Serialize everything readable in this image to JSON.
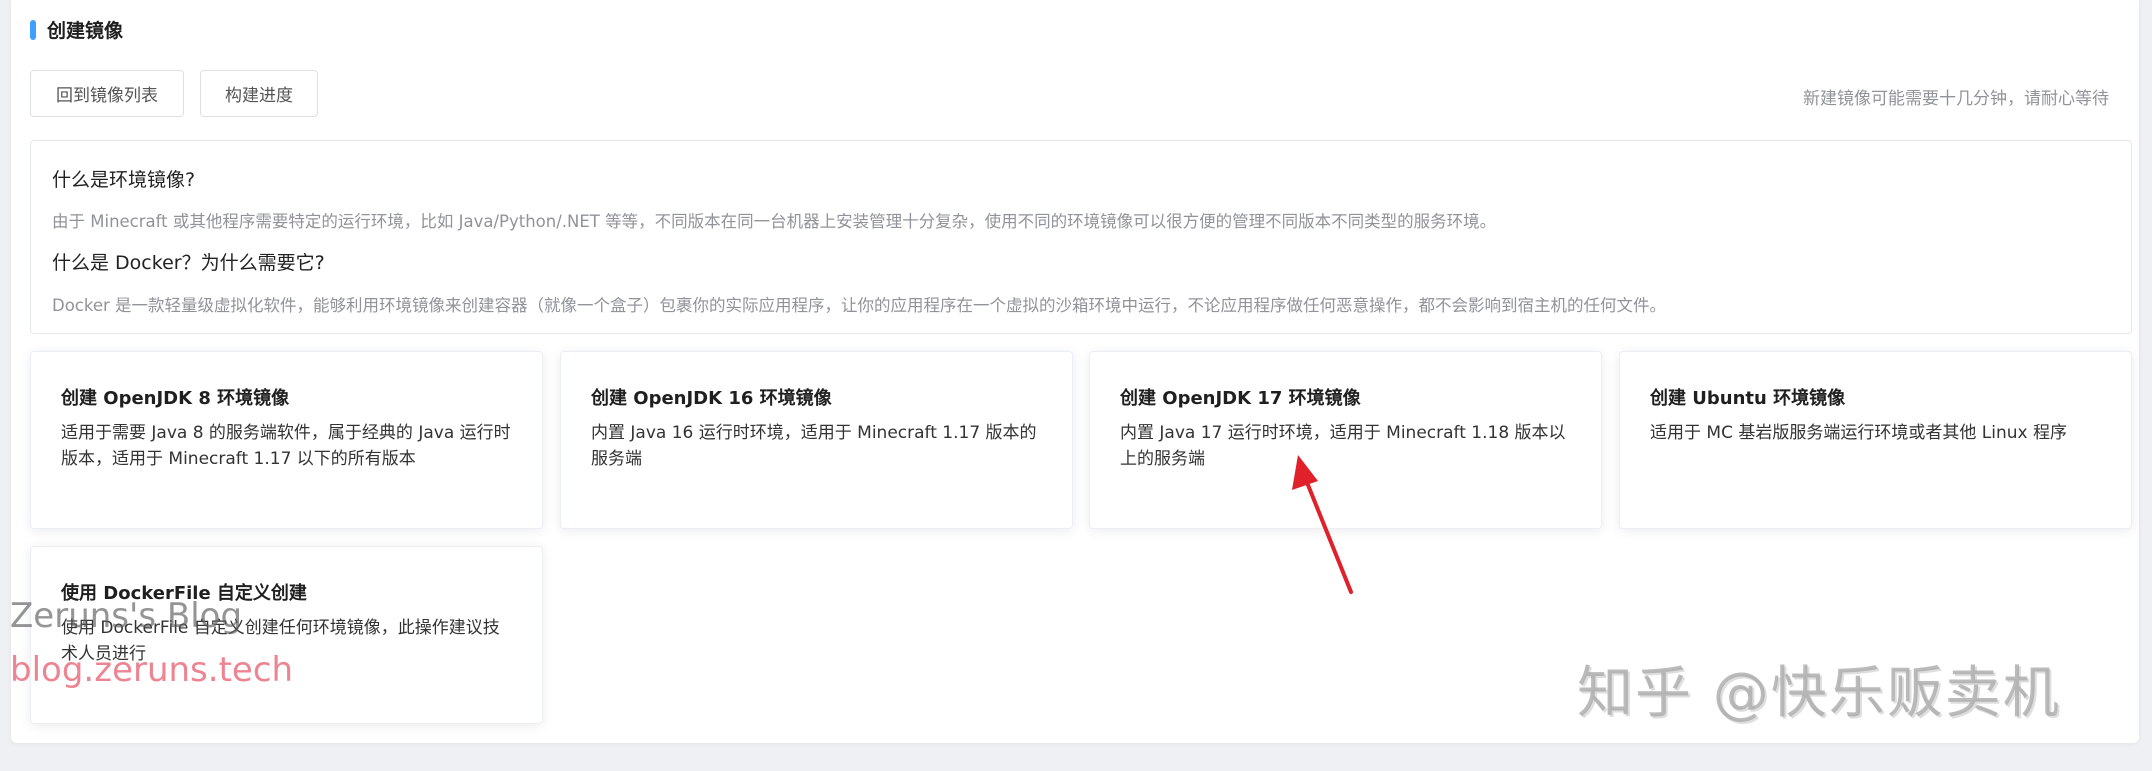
{
  "header": {
    "title": "创建镜像",
    "hint": "新建镜像可能需要十几分钟，请耐心等待"
  },
  "toolbar": {
    "back_label": "回到镜像列表",
    "progress_label": "构建进度"
  },
  "info": {
    "q1": "什么是环境镜像?",
    "a1": "由于 Minecraft 或其他程序需要特定的运行环境，比如 Java/Python/.NET 等等，不同版本在同一台机器上安装管理十分复杂，使用不同的环境镜像可以很方便的管理不同版本不同类型的服务环境。",
    "q2": "什么是 Docker？为什么需要它?",
    "a2": "Docker 是一款轻量级虚拟化软件，能够利用环境镜像来创建容器（就像一个盒子）包裹你的实际应用程序，让你的应用程序在一个虚拟的沙箱环境中运行，不论应用程序做任何恶意操作，都不会影响到宿主机的任何文件。"
  },
  "cards": [
    {
      "title": "创建 OpenJDK 8 环境镜像",
      "desc": "适用于需要 Java 8 的服务端软件，属于经典的 Java 运行时版本，适用于 Minecraft 1.17 以下的所有版本"
    },
    {
      "title": "创建 OpenJDK 16 环境镜像",
      "desc": "内置 Java 16 运行时环境，适用于 Minecraft 1.17 版本的服务端"
    },
    {
      "title": "创建 OpenJDK 17 环境镜像",
      "desc": "内置 Java 17 运行时环境，适用于 Minecraft 1.18 版本以上的服务端"
    },
    {
      "title": "创建 Ubuntu 环境镜像",
      "desc": "适用于 MC 基岩版服务端运行环境或者其他 Linux 程序"
    },
    {
      "title": "使用 DockerFile 自定义创建",
      "desc": "使用 DockerFile 自定义创建任何环境镜像，此操作建议技术人员进行"
    }
  ],
  "watermarks": {
    "blog_name": "Zeruns's Blog",
    "blog_url": "blog.zeruns.tech",
    "zhihu": "知乎 @快乐贩卖机"
  },
  "colors": {
    "accent": "#409eff",
    "arrow": "#e0202a"
  }
}
